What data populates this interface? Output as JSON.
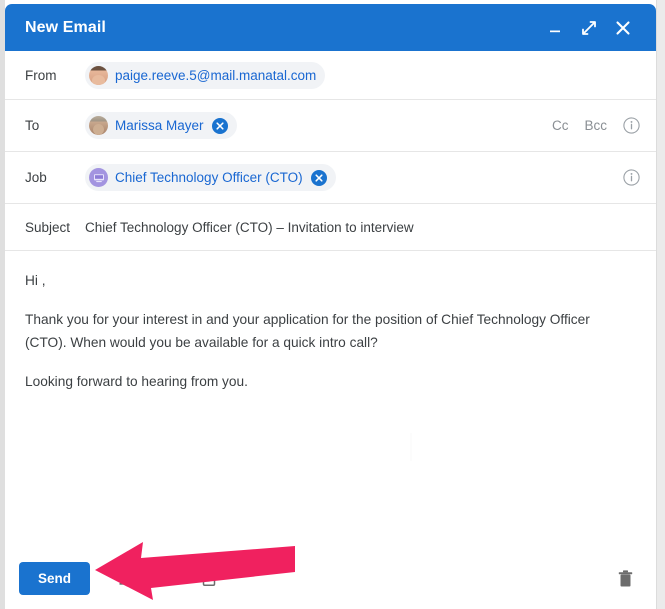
{
  "window": {
    "title": "New Email",
    "controls": [
      {
        "name": "minimize",
        "icon": "minimize-icon"
      },
      {
        "name": "expand",
        "icon": "expand-icon"
      },
      {
        "name": "close",
        "icon": "close-icon"
      }
    ],
    "header_color": "#1a73cf"
  },
  "fields": {
    "from": {
      "label": "From",
      "chip": {
        "text": "paige.reeve.5@mail.manatal.com",
        "avatar": "user-avatar-paige"
      }
    },
    "to": {
      "label": "To",
      "chip": {
        "text": "Marissa Mayer",
        "avatar": "user-avatar-marissa",
        "remove": "remove-chip-icon"
      },
      "cc_label": "Cc",
      "bcc_label": "Bcc",
      "info_icon": "info-icon"
    },
    "job": {
      "label": "Job",
      "chip": {
        "text": "Chief Technology Officer (CTO)",
        "icon": "job-icon",
        "remove": "remove-chip-icon"
      },
      "info_icon": "info-icon"
    },
    "subject": {
      "label": "Subject",
      "value": "Chief Technology Officer (CTO) – Invitation to interview"
    }
  },
  "body": {
    "greeting": "Hi ,",
    "paragraph_1": "Thank you for your interest in and your application for the position of Chief Technology Officer (CTO). When would you be available for a quick intro call?",
    "paragraph_2": "Looking forward to hearing from you."
  },
  "toolbar": {
    "send_label": "Send",
    "icons": [
      {
        "name": "formatting-icon"
      },
      {
        "name": "attachment-icon"
      },
      {
        "name": "template-icon"
      }
    ],
    "delete_icon": "delete-icon"
  },
  "annotation": {
    "arrow_color": "#F0215F",
    "points_to": "send-button"
  },
  "colors": {
    "accent_blue": "#1a73cf",
    "link_blue": "#1967d2",
    "chip_background": "#f1f3f6",
    "text_primary": "#3c4043",
    "text_muted": "#8a8f94"
  }
}
